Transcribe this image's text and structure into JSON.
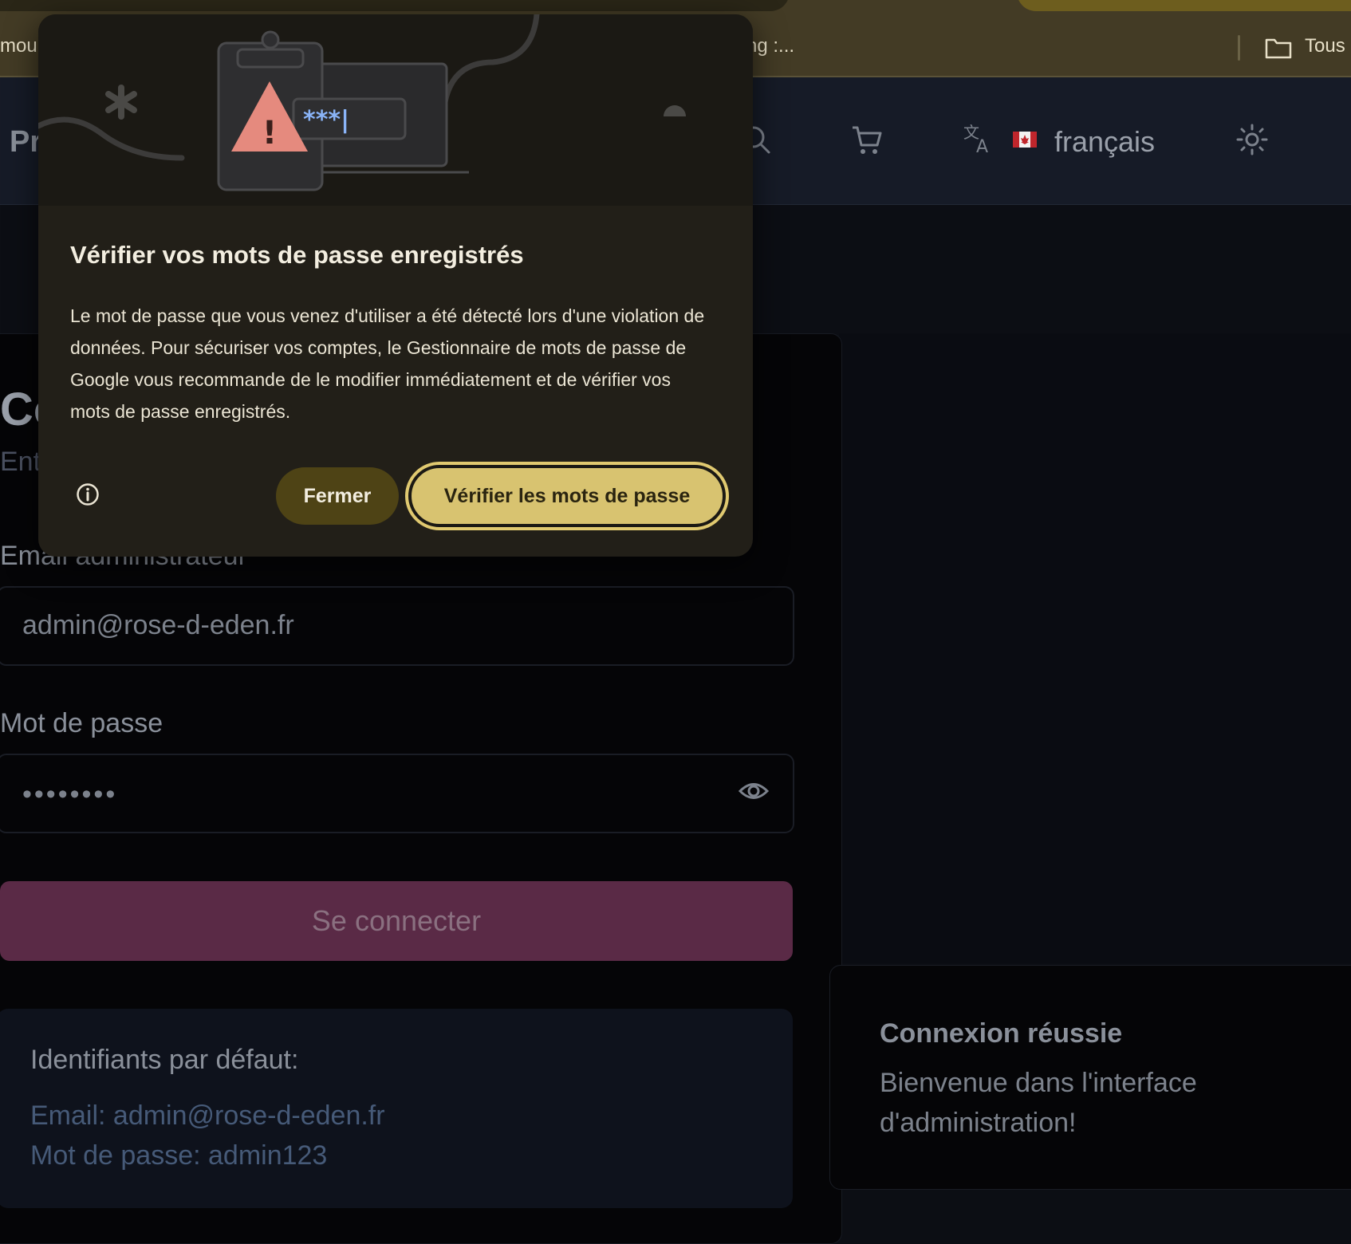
{
  "browser": {
    "bookmark_left": "mouk",
    "bookmark_mid": "ng :...",
    "bookmark_right": "Tous"
  },
  "header": {
    "brand_partial": "Pr",
    "language": "français",
    "icons": [
      "search-icon",
      "cart-icon",
      "translate-icon",
      "flag-canada-icon",
      "sun-icon"
    ]
  },
  "login": {
    "title_partial": "Co",
    "subtitle_partial": "Ent",
    "email_label": "Email administrateur",
    "email_value": "admin@rose-d-eden.fr",
    "password_label": "Mot de passe",
    "password_value": "••••••••",
    "submit_label": "Se connecter",
    "defaults_title": "Identifiants par défaut:",
    "defaults_email": "Email: admin@rose-d-eden.fr",
    "defaults_password": "Mot de passe: admin123"
  },
  "toast": {
    "title": "Connexion réussie",
    "message": "Bienvenue dans l'interface d'administration!"
  },
  "popup": {
    "illustration_text": "***|",
    "title": "Vérifier vos mots de passe enregistrés",
    "body": "Le mot de passe que vous venez d'utiliser a été détecté lors d'une violation de données. Pour sécuriser vos comptes, le Gestionnaire de mots de passe de Google vous recommande de le modifier immédiatement et de vérifier vos mots de passe enregistrés.",
    "close_label": "Fermer",
    "check_label": "Vérifier les mots de passe"
  },
  "colors": {
    "accent": "#d8c370",
    "login_button": "#5a2a46",
    "popup_bg": "#221f18"
  }
}
